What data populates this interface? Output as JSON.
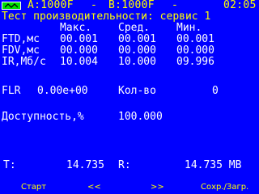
{
  "status": {
    "battery_icon": "battery-icon",
    "channel_a": "A:1000F",
    "dash1": "-",
    "channel_b": "B:1000F",
    "dash2": "-",
    "time": "02:05"
  },
  "title": "Тест производительности: сервис 1",
  "table": {
    "headers": [
      "Макс.",
      "Сред.",
      "Мин."
    ],
    "rows": [
      {
        "label": "FTD,мс",
        "max": "00.001",
        "avg": "00.001",
        "min": "00.001"
      },
      {
        "label": "FDV,мс",
        "max": "00.000",
        "avg": "00.000",
        "min": "00.000"
      },
      {
        "label": "IR,Мб/с",
        "max": "10.004",
        "avg": "10.000",
        "min": "09.996"
      }
    ]
  },
  "flr": {
    "label": "FLR",
    "value": "0.00e+00",
    "count_label": "Кол-во",
    "count_value": "0"
  },
  "availability": {
    "label": "Доступность,%",
    "value": "100.000"
  },
  "totals": {
    "t_label": "T:",
    "t_value": "14.735",
    "r_label": "R:",
    "r_value": "14.735 MB"
  },
  "softkeys": [
    "Старт",
    "<<",
    ">>",
    "Сохр./Загр."
  ]
}
